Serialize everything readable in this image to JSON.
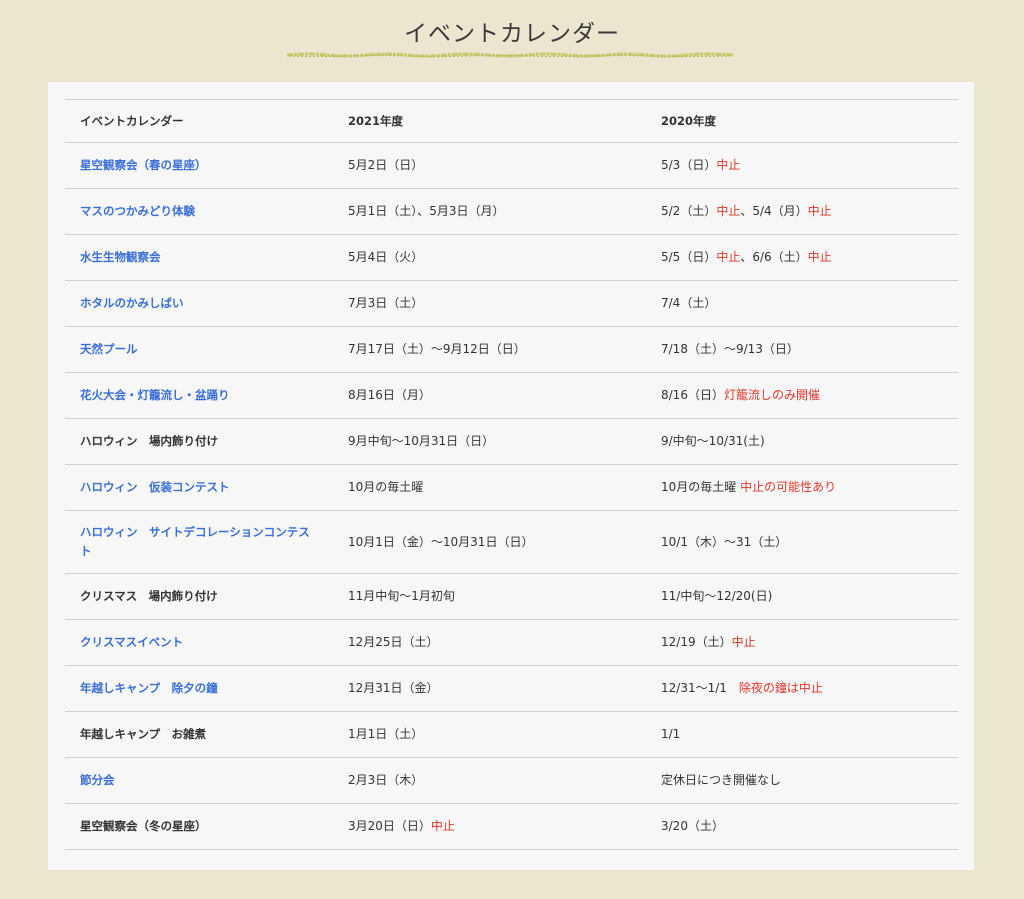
{
  "page": {
    "title": "イベントカレンダー"
  },
  "table": {
    "headers": [
      "イベントカレンダー",
      "2021年度",
      "2020年度"
    ],
    "rows": [
      {
        "event": "星空観察会（春の星座）",
        "link": true,
        "y2021": [
          {
            "t": "5月2日（日）"
          }
        ],
        "y2020": [
          {
            "t": "5/3（日）"
          },
          {
            "t": "中止",
            "red": true
          }
        ]
      },
      {
        "event": "マスのつかみどり体験",
        "link": true,
        "y2021": [
          {
            "t": "5月1日（土）、5月3日（月）"
          }
        ],
        "y2020": [
          {
            "t": "5/2（土）"
          },
          {
            "t": "中止",
            "red": true
          },
          {
            "t": "、5/4（月）"
          },
          {
            "t": "中止",
            "red": true
          }
        ]
      },
      {
        "event": "水生生物観察会",
        "link": true,
        "y2021": [
          {
            "t": "5月4日（火）"
          }
        ],
        "y2020": [
          {
            "t": "5/5（日）"
          },
          {
            "t": "中止",
            "red": true
          },
          {
            "t": "、6/6（土）"
          },
          {
            "t": "中止",
            "red": true
          }
        ]
      },
      {
        "event": "ホタルのかみしばい",
        "link": true,
        "y2021": [
          {
            "t": "7月3日（土）"
          }
        ],
        "y2020": [
          {
            "t": "7/4（土）"
          }
        ]
      },
      {
        "event": "天然プール",
        "link": true,
        "y2021": [
          {
            "t": "7月17日（土）〜9月12日（日）"
          }
        ],
        "y2020": [
          {
            "t": "7/18（土）〜9/13（日）"
          }
        ]
      },
      {
        "event": "花火大会・灯籠流し・盆踊り",
        "link": true,
        "y2021": [
          {
            "t": "8月16日（月）"
          }
        ],
        "y2020": [
          {
            "t": "8/16（日）"
          },
          {
            "t": "灯籠流しのみ開催",
            "red": true
          }
        ]
      },
      {
        "event": "ハロウィン　場内飾り付け",
        "link": false,
        "y2021": [
          {
            "t": "9月中旬〜10月31日（日）"
          }
        ],
        "y2020": [
          {
            "t": "9/中旬〜10/31(土)"
          }
        ]
      },
      {
        "event": "ハロウィン　仮装コンテスト",
        "link": true,
        "y2021": [
          {
            "t": "10月の毎土曜"
          }
        ],
        "y2020": [
          {
            "t": "10月の毎土曜 "
          },
          {
            "t": "中止の可能性あり",
            "red": true
          }
        ]
      },
      {
        "event": "ハロウィン　サイトデコレーションコンテスト",
        "link": true,
        "tall": true,
        "y2021": [
          {
            "t": "10月1日（金）〜10月31日（日）"
          }
        ],
        "y2020": [
          {
            "t": "10/1（木）〜31（土）"
          }
        ]
      },
      {
        "event": "クリスマス　場内飾り付け",
        "link": false,
        "y2021": [
          {
            "t": "11月中旬〜1月初旬"
          }
        ],
        "y2020": [
          {
            "t": "11/中旬〜12/20(日)"
          }
        ]
      },
      {
        "event": "クリスマスイベント",
        "link": true,
        "y2021": [
          {
            "t": "12月25日（土）"
          }
        ],
        "y2020": [
          {
            "t": "12/19（土）"
          },
          {
            "t": "中止",
            "red": true
          }
        ]
      },
      {
        "event": "年越しキャンプ　除夕の鐘",
        "link": true,
        "y2021": [
          {
            "t": "12月31日（金）"
          }
        ],
        "y2020": [
          {
            "t": "12/31〜1/1　"
          },
          {
            "t": "除夜の鐘は中止",
            "red": true
          }
        ]
      },
      {
        "event": "年越しキャンプ　お雑煮",
        "link": false,
        "y2021": [
          {
            "t": "1月1日（土）"
          }
        ],
        "y2020": [
          {
            "t": "1/1"
          }
        ]
      },
      {
        "event": "節分会",
        "link": true,
        "y2021": [
          {
            "t": "2月3日（木）"
          }
        ],
        "y2020": [
          {
            "t": "定休日につき開催なし"
          }
        ]
      },
      {
        "event": "星空観察会（冬の星座）",
        "link": false,
        "y2021": [
          {
            "t": "3月20日（日）"
          },
          {
            "t": "中止",
            "red": true
          }
        ],
        "y2020": [
          {
            "t": "3/20（土）"
          }
        ]
      }
    ]
  },
  "colors": {
    "background": "#ece5cf",
    "panel": "#f7f7f7",
    "link": "#3a6fd8",
    "note_red": "#e0372c",
    "underline": "#c9c86a"
  }
}
